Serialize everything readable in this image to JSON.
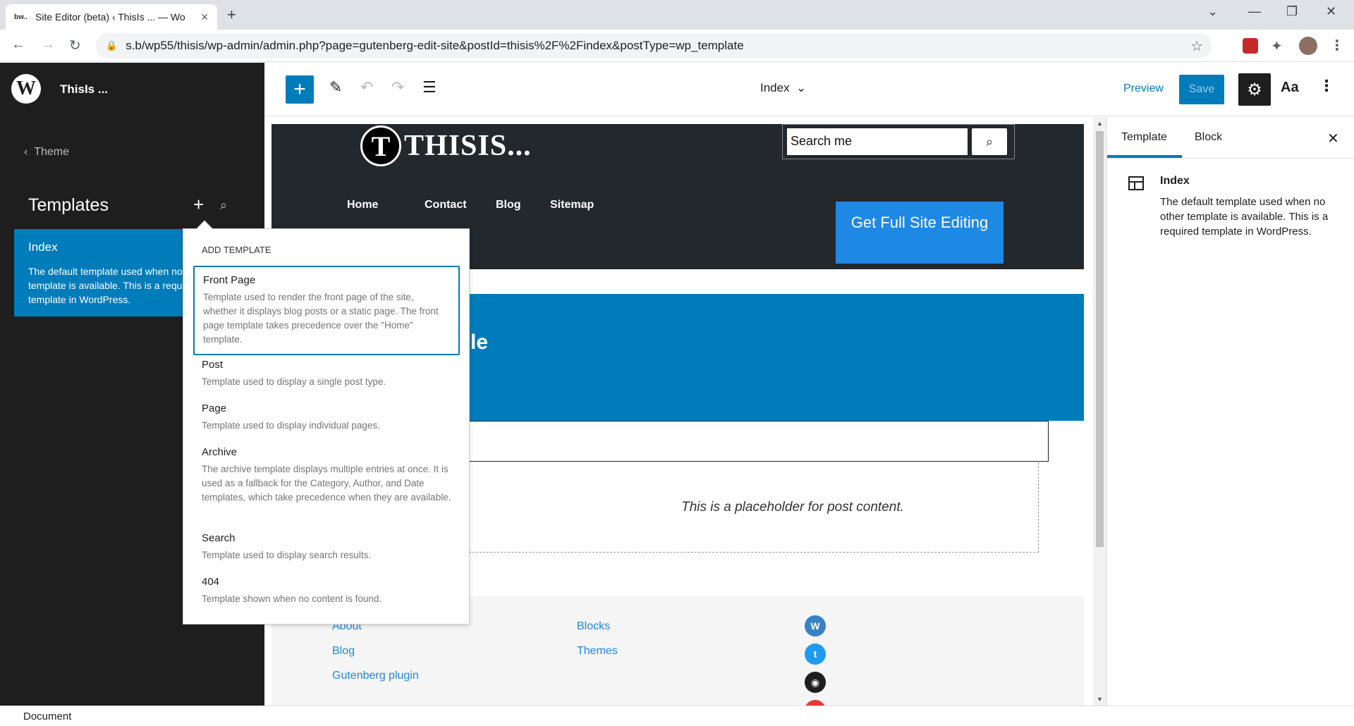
{
  "browser": {
    "tab_title": "Site Editor (beta) ‹ ThisIs ... — Wo",
    "tab_favicon": "bw..",
    "url": "s.b/wp55/thisis/wp-admin/admin.php?page=gutenberg-edit-site&postId=thisis%2F%2Findex&postType=wp_template"
  },
  "sidebar": {
    "site_title": "ThisIs ...",
    "logo": "W",
    "back_label": "Theme",
    "heading": "Templates",
    "index_card": {
      "title": "Index",
      "description": "The default template used when no other template is available. This is a required template in WordPress."
    }
  },
  "popover": {
    "heading": "ADD TEMPLATE",
    "options": [
      {
        "name": "Front Page",
        "description": "Template used to render the front page of the site, whether it displays blog posts or a static page. The front page template takes precedence over the \"Home\" template."
      },
      {
        "name": "Post",
        "description": "Template used to display a single post type."
      },
      {
        "name": "Page",
        "description": "Template used to display individual pages."
      },
      {
        "name": "Archive",
        "description": "The archive template displays multiple entries at once. It is used as a fallback for the Category, Author, and Date templates, which take precedence when they are available."
      },
      {
        "name": "Search",
        "description": "Template used to display search results."
      },
      {
        "name": "404",
        "description": "Template shown when no content is found."
      }
    ]
  },
  "toolbar": {
    "template_name": "Index",
    "preview_label": "Preview",
    "save_label": "Save",
    "styles_label": "Aa"
  },
  "canvas": {
    "logo_letter": "T",
    "logo_text": "THISIS...",
    "search_placeholder": "Search me",
    "nav": [
      "Home",
      "Contact",
      "Blog",
      "Sitemap"
    ],
    "cta_label": "Get Full Site Editing",
    "band_title_fragment": "le",
    "placeholder_text": "This is a placeholder for post content.",
    "footer_links_col1": [
      "About",
      "Blog",
      "Gutenberg plugin"
    ],
    "footer_links_col2": [
      "Blocks",
      "Themes"
    ],
    "social_icons": [
      "wordpress-icon",
      "twitter-icon",
      "github-icon"
    ]
  },
  "panel": {
    "tab_template": "Template",
    "tab_block": "Block",
    "title": "Index",
    "description": "The default template used when no other template is available. This is a required template in WordPress."
  },
  "status": {
    "label": "Document"
  },
  "colors": {
    "accent": "#007cba",
    "sidebar_bg": "#1e1e1e",
    "header_bg": "#23282d",
    "cta": "#1e88e5"
  }
}
